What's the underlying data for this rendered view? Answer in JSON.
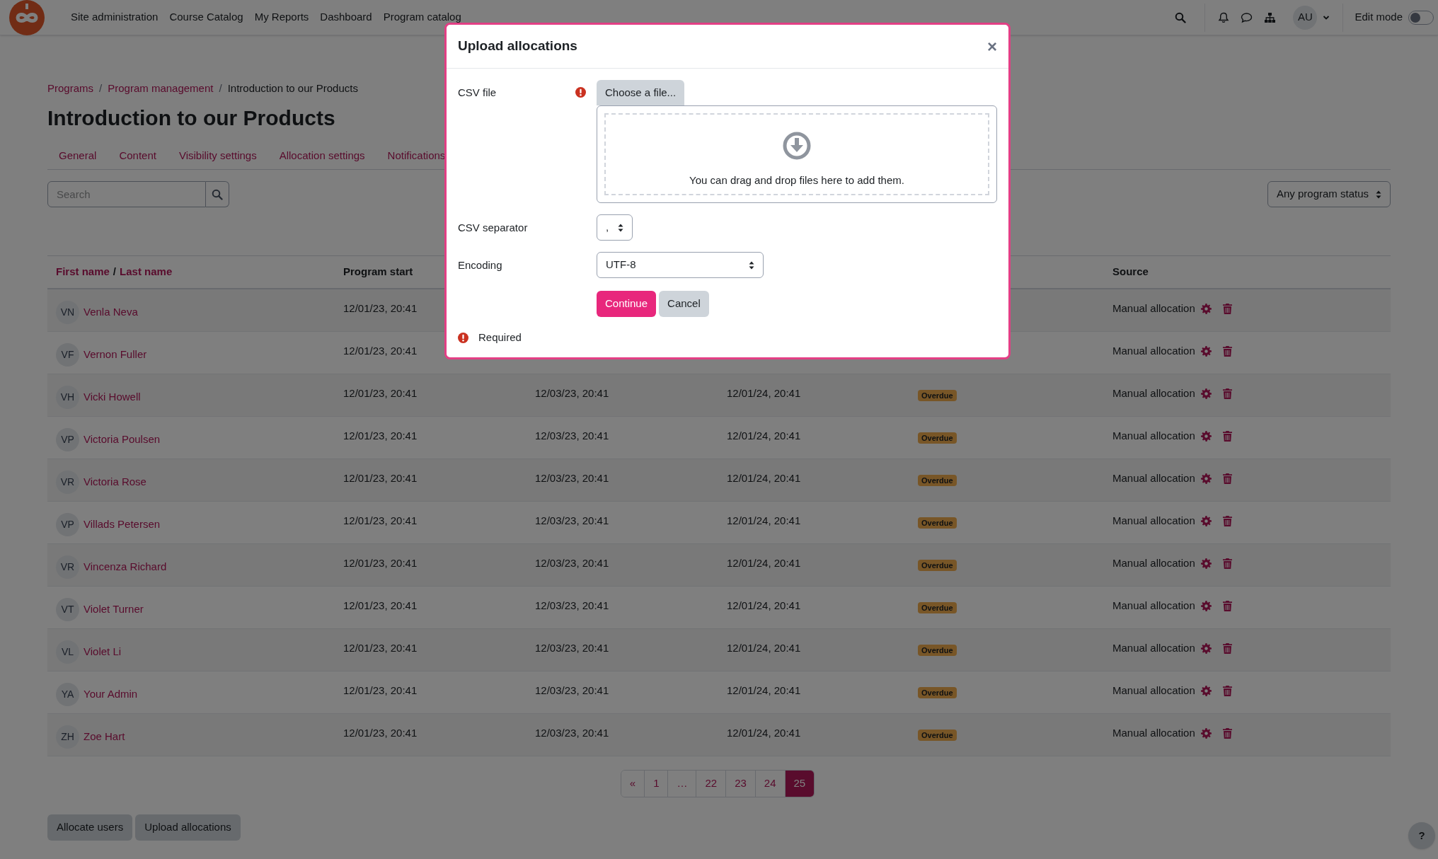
{
  "navbar": {
    "links": [
      "Site administration",
      "Course Catalog",
      "My Reports",
      "Dashboard",
      "Program catalog"
    ],
    "avatar": "AU",
    "edit_mode": {
      "label": "Edit mode",
      "on": false
    }
  },
  "breadcrumb": [
    {
      "label": "Programs",
      "link": true
    },
    {
      "separator": "/",
      "label": "Program management",
      "link": true
    },
    {
      "separator": "/",
      "label": "Introduction to our Products",
      "link": false
    }
  ],
  "title": "Introduction to our Products",
  "tabs": [
    {
      "label": "General",
      "selected": false
    },
    {
      "label": "Content",
      "selected": false
    },
    {
      "label": "Visibility settings",
      "selected": false
    },
    {
      "label": "Allocation settings",
      "selected": false
    },
    {
      "label": "Notifications",
      "selected": false
    }
  ],
  "search": {
    "placeholder": "Search"
  },
  "status_filter": "Any program status",
  "table": {
    "columns": [
      {
        "kind": "name",
        "first": "First name",
        "sep": "/",
        "last": "Last name"
      },
      {
        "kind": "text",
        "label": "Program start"
      },
      {
        "kind": "blank"
      },
      {
        "kind": "blank"
      },
      {
        "kind": "blank"
      },
      {
        "kind": "text",
        "label": "Source"
      }
    ],
    "rows": [
      {
        "initials": "VN",
        "name": "Venla Neva",
        "start": "12/01/23, 20:41",
        "source": "Manual allocation"
      },
      {
        "initials": "VF",
        "name": "Vernon Fuller",
        "start": "12/01/23, 20:41",
        "source": "Manual allocation"
      },
      {
        "initials": "VH",
        "name": "Vicki Howell",
        "start": "12/01/23, 20:41",
        "column_3": "12/03/23, 20:41",
        "column_4": "12/01/24, 20:41",
        "status": "Overdue",
        "source": "Manual allocation"
      },
      {
        "initials": "VP",
        "name": "Victoria Poulsen",
        "start": "12/01/23, 20:41",
        "column_3": "12/03/23, 20:41",
        "column_4": "12/01/24, 20:41",
        "status": "Overdue",
        "source": "Manual allocation"
      },
      {
        "initials": "VR",
        "name": "Victoria Rose",
        "start": "12/01/23, 20:41",
        "column_3": "12/03/23, 20:41",
        "column_4": "12/01/24, 20:41",
        "status": "Overdue",
        "source": "Manual allocation"
      },
      {
        "initials": "VP",
        "name": "Villads Petersen",
        "start": "12/01/23, 20:41",
        "column_3": "12/03/23, 20:41",
        "column_4": "12/01/24, 20:41",
        "status": "Overdue",
        "source": "Manual allocation"
      },
      {
        "initials": "VR",
        "name": "Vincenza Richard",
        "start": "12/01/23, 20:41",
        "column_3": "12/03/23, 20:41",
        "column_4": "12/01/24, 20:41",
        "status": "Overdue",
        "source": "Manual allocation"
      },
      {
        "initials": "VT",
        "name": "Violet Turner",
        "start": "12/01/23, 20:41",
        "column_3": "12/03/23, 20:41",
        "column_4": "12/01/24, 20:41",
        "status": "Overdue",
        "source": "Manual allocation"
      },
      {
        "initials": "VL",
        "name": "Violet Li",
        "start": "12/01/23, 20:41",
        "column_3": "12/03/23, 20:41",
        "column_4": "12/01/24, 20:41",
        "status": "Overdue",
        "source": "Manual allocation"
      },
      {
        "initials": "YA",
        "name": "Your Admin",
        "start": "12/01/23, 20:41",
        "column_3": "12/03/23, 20:41",
        "column_4": "12/01/24, 20:41",
        "status": "Overdue",
        "source": "Manual allocation"
      },
      {
        "initials": "ZH",
        "name": "Zoe Hart",
        "start": "12/01/23, 20:41",
        "column_3": "12/03/23, 20:41",
        "column_4": "12/01/24, 20:41",
        "status": "Overdue",
        "source": "Manual allocation"
      }
    ]
  },
  "pagination": [
    {
      "label": "«",
      "selected": false
    },
    {
      "label": "1",
      "selected": false
    },
    {
      "label": "…",
      "selected": false
    },
    {
      "label": "22",
      "selected": false
    },
    {
      "label": "23",
      "selected": false
    },
    {
      "label": "24",
      "selected": false
    },
    {
      "label": "25",
      "selected": true
    }
  ],
  "buttons": [
    "Allocate users",
    "Upload allocations"
  ],
  "help": "?",
  "modal": {
    "title": "Upload allocations",
    "close": "×",
    "csv_file": {
      "label": "CSV file",
      "required": true,
      "button": "Choose a file...",
      "drop_text": "You can drag and drop files here to add them."
    },
    "separator": {
      "label": "CSV separator",
      "value": ","
    },
    "encoding": {
      "label": "Encoding",
      "value": "UTF-8"
    },
    "actions": [
      "Continue",
      "Cancel"
    ],
    "required_note": "Required"
  }
}
